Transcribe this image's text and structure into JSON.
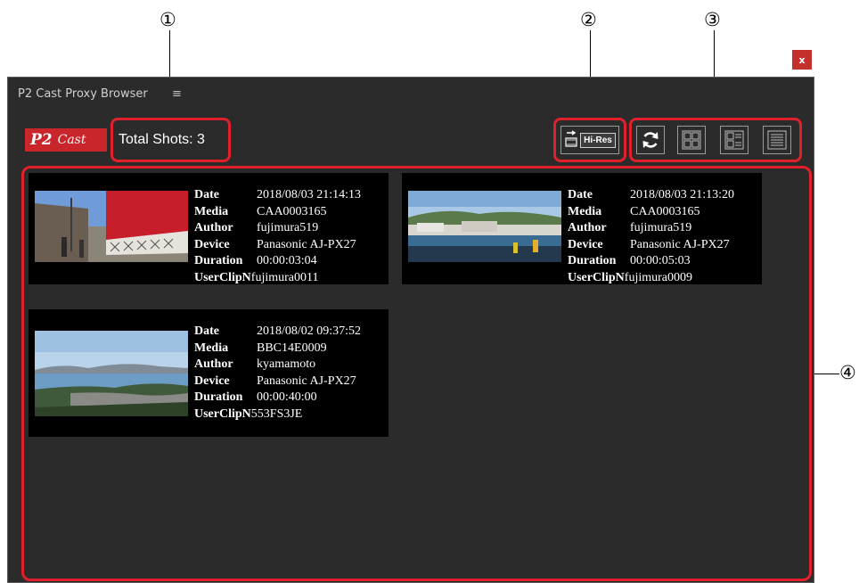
{
  "callouts": [
    "①",
    "②",
    "③",
    "④"
  ],
  "window": {
    "close_label": "x",
    "title": "P2 Cast Proxy Browser",
    "menu_icon": "≡"
  },
  "logo": {
    "p2": "P2",
    "cast": "Cast"
  },
  "total_shots_label": "Total Shots: 3",
  "toolbar": {
    "hires_label": "Hi-Res",
    "icons": [
      "refresh-icon",
      "large-thumbnail-view-icon",
      "thumbnail-list-view-icon",
      "list-view-icon"
    ]
  },
  "clips": [
    {
      "date_label": "Date",
      "date": "2018/08/03 21:14:13",
      "media_label": "Media",
      "media": "CAA0003165",
      "author_label": "Author",
      "author": "fujimura519",
      "device_label": "Device",
      "device": "Panasonic  AJ-PX27",
      "duration_label": "Duration",
      "duration": "00:00:03:04",
      "userclip_label": "UserClipN",
      "userclip": "fujimura0011"
    },
    {
      "date_label": "Date",
      "date": "2018/08/03 21:13:20",
      "media_label": "Media",
      "media": "CAA0003165",
      "author_label": "Author",
      "author": "fujimura519",
      "device_label": "Device",
      "device": "Panasonic  AJ-PX27",
      "duration_label": "Duration",
      "duration": "00:00:05:03",
      "userclip_label": "UserClipN",
      "userclip": "fujimura0009"
    },
    {
      "date_label": "Date",
      "date": "2018/08/02 09:37:52",
      "media_label": "Media",
      "media": "BBC14E0009",
      "author_label": "Author",
      "author": "kyamamoto",
      "device_label": "Device",
      "device": "Panasonic  AJ-PX27",
      "duration_label": "Duration",
      "duration": "00:00:40:00",
      "userclip_label": "UserClipN",
      "userclip": "553FS3JE"
    }
  ],
  "colors": {
    "highlight": "#e0202a",
    "panel": "#2b2b2b",
    "logo": "#c8262b"
  }
}
